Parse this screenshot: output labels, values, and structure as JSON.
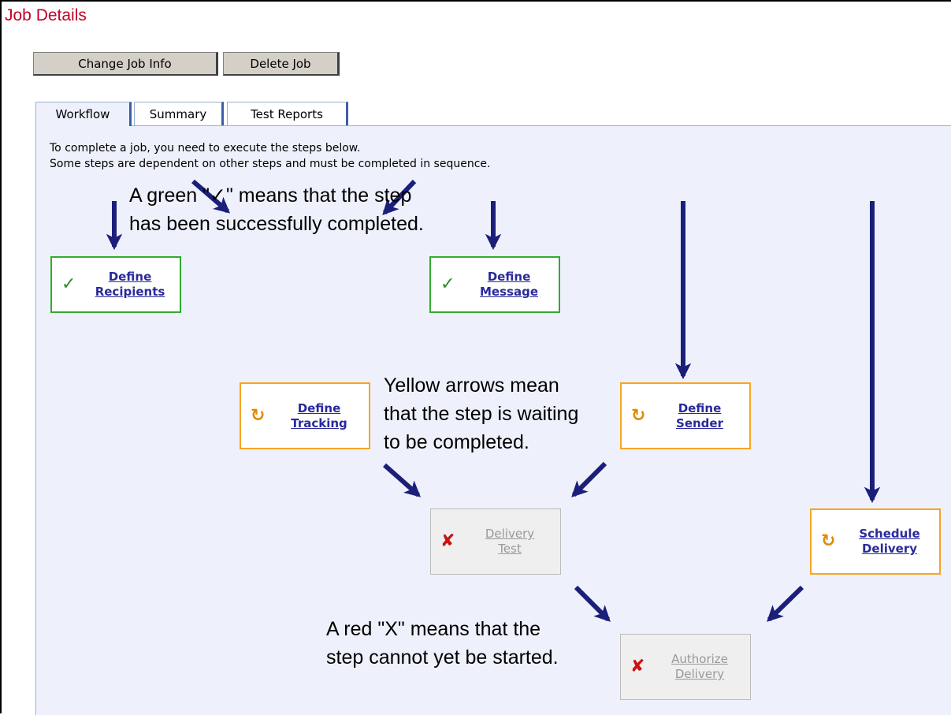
{
  "page": {
    "title": "Job Details"
  },
  "toolbar": {
    "change_label": "Change Job Info",
    "delete_label": "Delete Job"
  },
  "tabs": [
    {
      "label": "Workflow",
      "active": true
    },
    {
      "label": "Summary",
      "active": false
    },
    {
      "label": "Test Reports",
      "active": false
    }
  ],
  "intro": {
    "line1": "To complete a job, you need to execute the steps below.",
    "line2": "Some steps are dependent on other steps and must be completed in sequence."
  },
  "notes": {
    "green": {
      "line1": "A green \"✓\" means that the step",
      "line2": "has been successfully completed."
    },
    "yellow": {
      "line1": "Yellow arrows mean",
      "line2": "that the step is waiting",
      "line3": "to be completed."
    },
    "red": {
      "line1": "A red \"X\" means that the",
      "line2": "step cannot yet be started."
    }
  },
  "steps": {
    "recipients": {
      "line1": "Define",
      "line2": "Recipients",
      "status": "complete",
      "icon": "check-icon"
    },
    "message": {
      "line1": "Define",
      "line2": "Message",
      "status": "complete",
      "icon": "check-icon"
    },
    "tracking": {
      "line1": "Define",
      "line2": "Tracking",
      "status": "waiting",
      "icon": "refresh-icon"
    },
    "sender": {
      "line1": "Define",
      "line2": "Sender",
      "status": "waiting",
      "icon": "refresh-icon"
    },
    "test": {
      "line1": "Delivery",
      "line2": "Test",
      "status": "blocked",
      "icon": "cross-icon"
    },
    "schedule": {
      "line1": "Schedule",
      "line2": "Delivery",
      "status": "waiting",
      "icon": "refresh-icon"
    },
    "authorize": {
      "line1": "Authorize",
      "line2": "Delivery",
      "status": "blocked",
      "icon": "cross-icon"
    }
  },
  "colors": {
    "title": "#c0002a",
    "panel_bg": "#eef1fb",
    "complete_border": "#33aa33",
    "waiting_border": "#f5a623",
    "blocked_bg": "#efefef",
    "link": "#2a2a9c",
    "arrow": "#1b1f7a"
  }
}
